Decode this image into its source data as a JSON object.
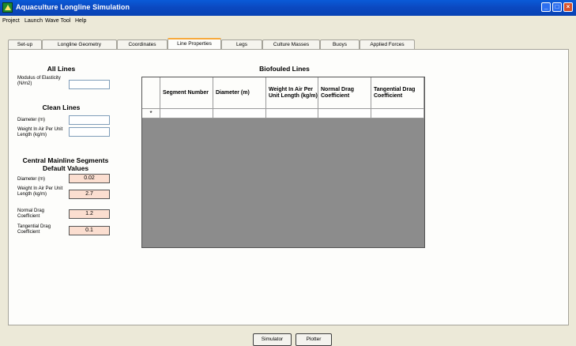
{
  "window": {
    "title": "Aquaculture Longline Simulation"
  },
  "menu": {
    "items": [
      "Project",
      "Launch",
      "Wave Tool",
      "Help"
    ]
  },
  "tabs": [
    "Set-up",
    "Longline Geometry",
    "Coordinates",
    "Line Properties",
    "Legs",
    "Culture Masses",
    "Buoys",
    "Applied Forces"
  ],
  "active_tab": "Line Properties",
  "all_lines": {
    "title": "All Lines",
    "modulus_label": "Modulus of Elasticity (N/m2)",
    "modulus_value": ""
  },
  "clean_lines": {
    "title": "Clean Lines",
    "diameter_label": "Diameter (m)",
    "diameter_value": "",
    "weight_label": "Weight In Air Per Unit Length (kg/m)",
    "weight_value": ""
  },
  "central_mainline": {
    "title_line1": "Central Mainline Segments",
    "title_line2": "Default Values",
    "diameter_label": "Diameter (m)",
    "diameter_value": "0.02",
    "weight_label": "Weight In Air Per Unit Length (kg/m)",
    "weight_value": "2.7",
    "normal_drag_label": "Normal Drag Coefficient",
    "normal_drag_value": "1.2",
    "tangential_drag_label": "Tangential Drag Coefficient",
    "tangential_drag_value": "0.1"
  },
  "biofouled": {
    "title": "Biofouled Lines",
    "columns": [
      "Segment Number",
      "Diameter (m)",
      "Weight In Air Per Unit Length (kg/m)",
      "Normal Drag Coefficient",
      "Tangential Drag Coefficient"
    ],
    "new_row_marker": "*"
  },
  "buttons": {
    "simulator": "Simulator",
    "plotter": "Plotter"
  },
  "colors": {
    "titlebar": "#0a5bd8",
    "default_value_bg": "#fbded0",
    "active_tab_accent": "#f7a93a",
    "grid_empty_bg": "#8c8c8c"
  }
}
